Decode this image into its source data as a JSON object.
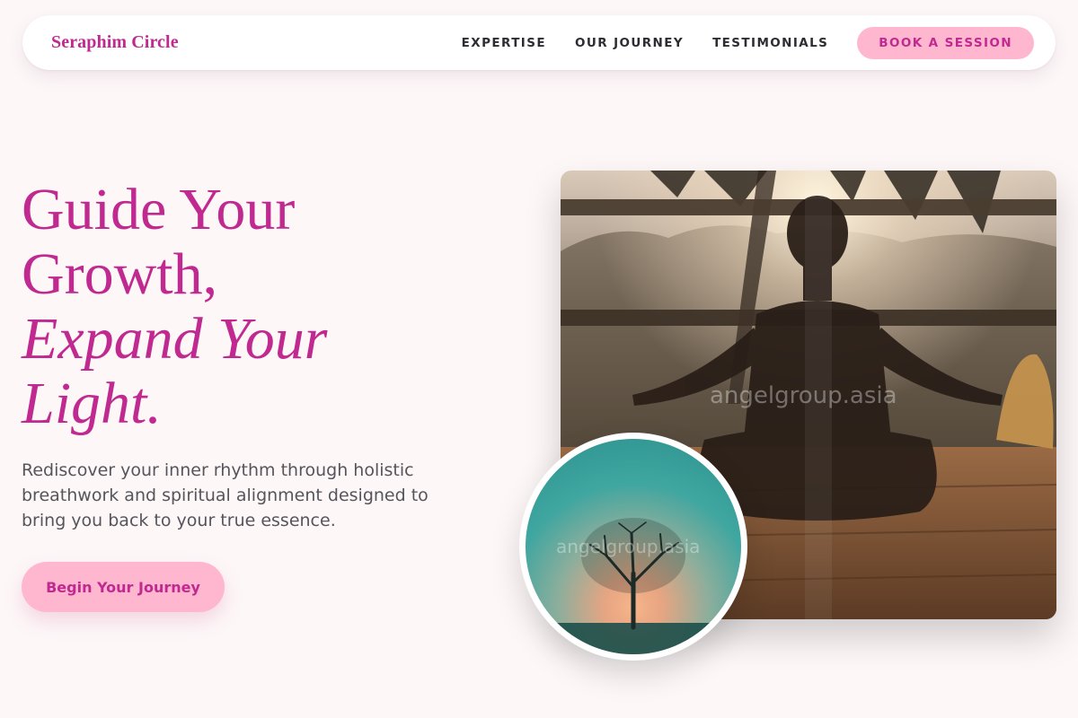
{
  "nav": {
    "brand": "Seraphim Circle",
    "links": [
      "EXPERTISE",
      "OUR JOURNEY",
      "TESTIMONIALS"
    ],
    "cta": "BOOK A SESSION"
  },
  "hero": {
    "title_line1": "Guide Your",
    "title_line2": "Growth,",
    "title_line3": "Expand Your",
    "title_line4": "Light.",
    "subtitle": "Rediscover your inner rhythm through holistic breathwork and spiritual alignment designed to bring you back to your true essence.",
    "cta": "Begin Your Journey"
  },
  "images": {
    "main_watermark": "angelgroup.asia",
    "circle_watermark": "angelgroup.asia"
  },
  "colors": {
    "accent": "#c02a90",
    "button_bg": "#ffb6cf",
    "page_bg": "#fdf7f8"
  }
}
